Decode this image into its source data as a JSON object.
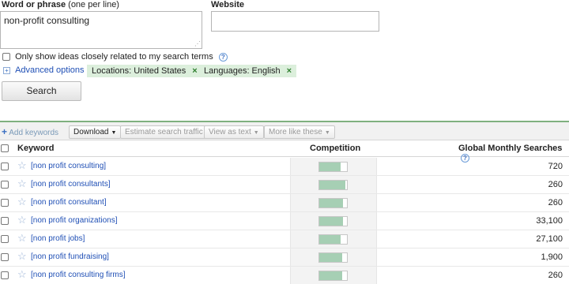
{
  "form": {
    "word_label": "Word or phrase",
    "word_hint": "(one per line)",
    "word_value": "non-profit consulting",
    "website_label": "Website",
    "website_value": "",
    "only_related_label": "Only show ideas closely related to my search terms",
    "advanced_options_label": "Advanced options",
    "chips": [
      {
        "label": "Locations: United States"
      },
      {
        "label": "Languages: English"
      }
    ],
    "search_button": "Search"
  },
  "toolbar": {
    "add_keywords": "Add keywords",
    "download": "Download",
    "estimate": "Estimate search traffic",
    "view_as_text": "View as text",
    "more_like_these": "More like these"
  },
  "table": {
    "headers": {
      "keyword": "Keyword",
      "competition": "Competition",
      "gms": "Global Monthly Searches"
    },
    "rows": [
      {
        "keyword": "[non profit consulting]",
        "competition": 0.78,
        "gms": "720"
      },
      {
        "keyword": "[non profit consultants]",
        "competition": 0.95,
        "gms": "260"
      },
      {
        "keyword": "[non profit consultant]",
        "competition": 0.86,
        "gms": "260"
      },
      {
        "keyword": "[non profit organizations]",
        "competition": 0.86,
        "gms": "33,100"
      },
      {
        "keyword": "[non profit jobs]",
        "competition": 0.78,
        "gms": "27,100"
      },
      {
        "keyword": "[non profit fundraising]",
        "competition": 0.82,
        "gms": "1,900"
      },
      {
        "keyword": "[non profit consulting firms]",
        "competition": 0.84,
        "gms": "260"
      }
    ]
  },
  "colors": {
    "competition_fill": "#a6cfb4",
    "link": "#1f4fb5",
    "chip_bg": "#dcefdc",
    "toolbar_border": "#7fb07f"
  }
}
